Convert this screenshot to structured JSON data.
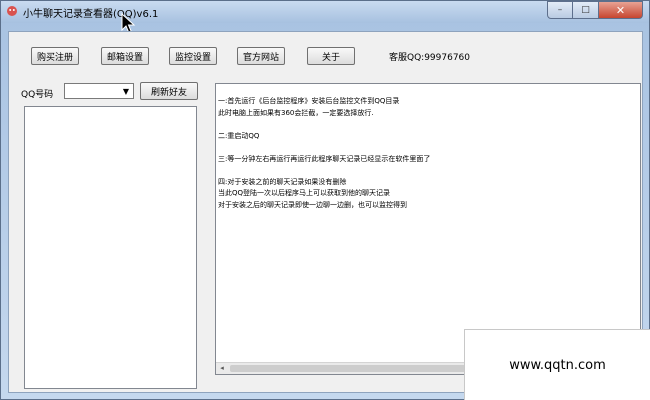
{
  "window": {
    "title": "小牛聊天记录查看器(QQ)v6.1",
    "controls": {
      "minimize": "–",
      "maximize": "□",
      "close": "✕"
    }
  },
  "toolbar": {
    "buy_label": "购买注册",
    "mail_label": "邮箱设置",
    "monitor_label": "监控设置",
    "website_label": "官方网站",
    "about_label": "关于",
    "support_text": "客服QQ:99976760"
  },
  "left_panel": {
    "qq_label": "QQ号码",
    "qq_selected": "",
    "refresh_label": "刷新好友"
  },
  "log": {
    "lines": [
      "一:首先运行《后台监控程序》安装后台监控文件到QQ目录",
      "此时电脑上面如果有360会拦截，一定要选择放行.",
      "",
      "二:重启动QQ",
      "",
      "三:等一分钟左右再运行再运行此程序聊天记录已经显示在软件里面了",
      "",
      "四:对于安装之前的聊天记录如果没有删除",
      "当此QQ登陆一次以后程序马上可以获取到他的聊天记录",
      "对于安装之后的聊天记录即使一边聊一边删，也可以监控得到"
    ]
  },
  "watermark": {
    "text": "www.qqtn.com"
  }
}
